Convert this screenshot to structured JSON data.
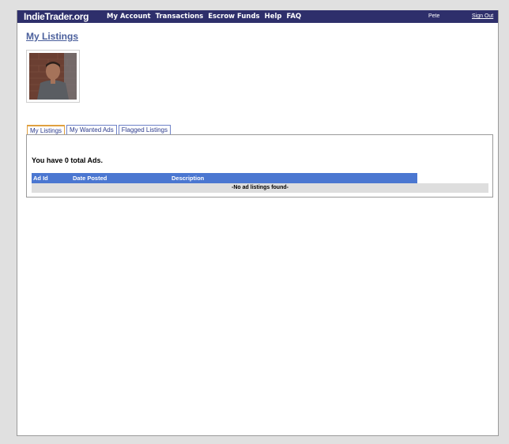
{
  "navbar": {
    "brand": "IndieTrader.org",
    "links": [
      "My Account",
      "Transactions",
      "Escrow Funds",
      "Help",
      "FAQ"
    ],
    "user": "Pete",
    "sign_out": "Sign Out"
  },
  "page": {
    "title": "My Listings"
  },
  "tabs": [
    {
      "label": "My Listings",
      "active": true
    },
    {
      "label": "My Wanted Ads",
      "active": false
    },
    {
      "label": "Flagged Listings",
      "active": false
    }
  ],
  "listings": {
    "summary": "You have 0 total Ads.",
    "columns": [
      "Ad Id",
      "Date Posted",
      "Description"
    ],
    "empty_message": "-No ad listings found-"
  },
  "colors": {
    "navbar": "#2e2f6b",
    "title": "#4a5f9c",
    "grid_header": "#4b77d1",
    "active_tab_accent": "#e0a040"
  }
}
